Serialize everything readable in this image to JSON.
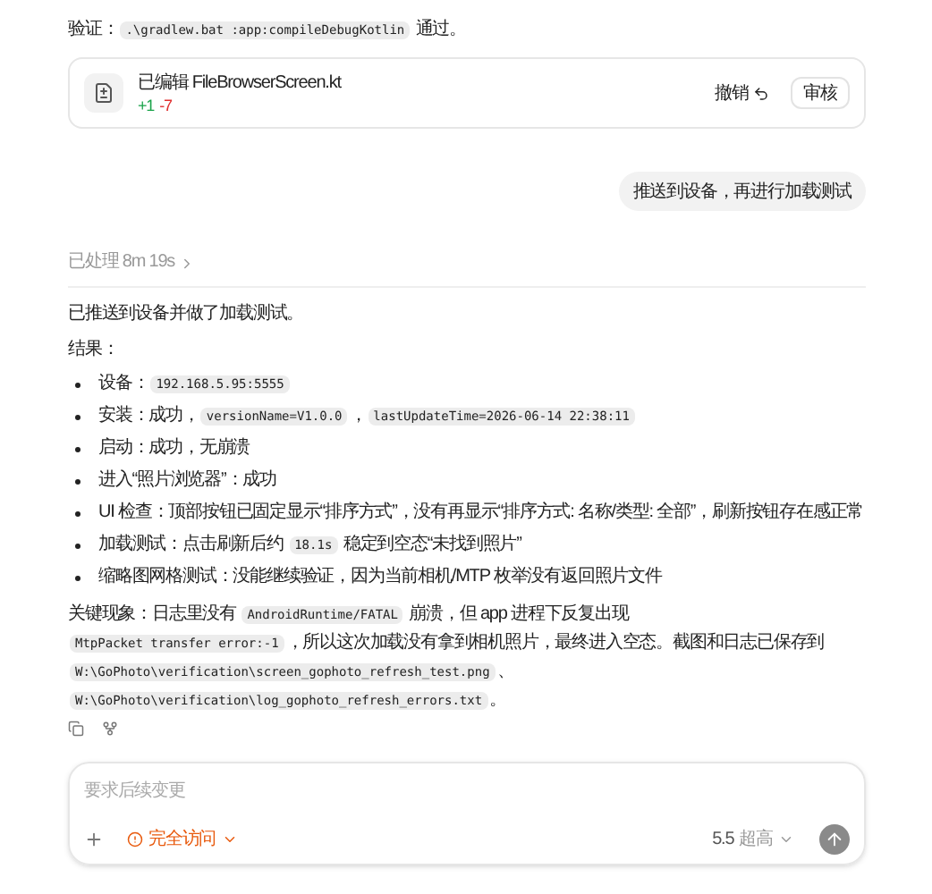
{
  "verify_line": [
    {
      "kind": "text",
      "text": "验证："
    },
    {
      "kind": "code",
      "text": ".\\gradlew.bat :app:compileDebugKotlin"
    },
    {
      "kind": "text",
      "text": " 通过。"
    }
  ],
  "edit_card": {
    "title": "已编辑 FileBrowserScreen.kt",
    "added": "+1",
    "removed": "-7",
    "undo": "撤销",
    "review": "审核"
  },
  "user_message": "推送到设备，再进行加载测试",
  "processed": {
    "label": "已处理 8m 19s",
    "expanded": false
  },
  "reply": {
    "intro": "已推送到设备并做了加载测试。",
    "results_label": "结果：",
    "bullets": [
      [
        {
          "kind": "text",
          "text": "设备："
        },
        {
          "kind": "code",
          "text": "192.168.5.95:5555"
        }
      ],
      [
        {
          "kind": "text",
          "text": "安装：成功，"
        },
        {
          "kind": "code",
          "text": "versionName=V1.0.0"
        },
        {
          "kind": "text",
          "text": "，"
        },
        {
          "kind": "code",
          "text": "lastUpdateTime=2026-06-14 22:38:11"
        }
      ],
      [
        {
          "kind": "text",
          "text": "启动：成功，无崩溃"
        }
      ],
      [
        {
          "kind": "text",
          "text": "进入“照片浏览器”：成功"
        }
      ],
      [
        {
          "kind": "text",
          "text": "UI 检查：顶部按钮已固定显示“排序方式”，没有再显示“排序方式: 名称/类型: 全部”，刷新按钮存在感正常"
        }
      ],
      [
        {
          "kind": "text",
          "text": "加载测试：点击刷新后约 "
        },
        {
          "kind": "code",
          "text": "18.1s"
        },
        {
          "kind": "text",
          "text": " 稳定到空态“未找到照片”"
        }
      ],
      [
        {
          "kind": "text",
          "text": "缩略图网格测试：没能继续验证，因为当前相机/MTP 枚举没有返回照片文件"
        }
      ]
    ],
    "summary": [
      {
        "kind": "text",
        "text": "关键现象：日志里没有 "
      },
      {
        "kind": "code",
        "text": "AndroidRuntime/FATAL"
      },
      {
        "kind": "text",
        "text": " 崩溃，但 app 进程下反复出现 "
      },
      {
        "kind": "code",
        "text": "MtpPacket transfer error:-1"
      },
      {
        "kind": "text",
        "text": "，所以这次加载没有拿到相机照片，最终进入空态。截图和日志已保存到 "
      },
      {
        "kind": "code",
        "text": "W:\\GoPhoto\\verification\\screen_gophoto_refresh_test.png"
      },
      {
        "kind": "text",
        "text": "、"
      },
      {
        "kind": "break"
      },
      {
        "kind": "code",
        "text": "W:\\GoPhoto\\verification\\log_gophoto_refresh_errors.txt"
      },
      {
        "kind": "text",
        "text": "。"
      }
    ]
  },
  "composer": {
    "placeholder": "要求后续变更",
    "access": "完全访问",
    "model": "5.5",
    "effort": "超高"
  }
}
